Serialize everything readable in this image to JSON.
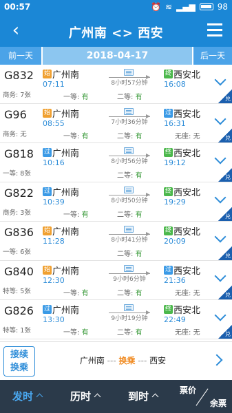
{
  "status_bar": {
    "time": "00:57",
    "battery": "98"
  },
  "header": {
    "title": "广州南 <> 西安",
    "back_icon": "back-chevron-icon",
    "menu_icon": "menu-icon"
  },
  "date_nav": {
    "prev_label": "前一天",
    "date": "2018-04-17",
    "next_label": "后一天"
  },
  "trains": [
    {
      "number": "G832",
      "origin_tag": "始",
      "origin": "广州南",
      "depart": "07:11",
      "duration": "8小时57分钟",
      "dest_tag": "终",
      "dest": "西安北",
      "arrive": "16:08",
      "seat_left": "商务: 7张",
      "seat_mid_label": "一等:",
      "seat_mid": "有",
      "seat_mid2_label": "二等:",
      "seat_mid2": "有",
      "seat_right_label": "",
      "seat_right": "",
      "redeem": "兑"
    },
    {
      "number": "G96",
      "origin_tag": "始",
      "origin": "广州南",
      "depart": "08:55",
      "duration": "7小时36分钟",
      "dest_tag": "过",
      "dest": "西安北",
      "arrive": "16:31",
      "seat_left": "商务: 无",
      "seat_mid_label": "一等:",
      "seat_mid": "有",
      "seat_mid2_label": "二等:",
      "seat_mid2": "有",
      "seat_right_label": "无座:",
      "seat_right": "无",
      "redeem": "兑"
    },
    {
      "number": "G818",
      "origin_tag": "过",
      "origin": "广州南",
      "depart": "10:16",
      "duration": "8小时56分钟",
      "dest_tag": "终",
      "dest": "西安北",
      "arrive": "19:12",
      "seat_left": "一等: 8张",
      "seat_mid_label": "",
      "seat_mid": "",
      "seat_mid2_label": "二等:",
      "seat_mid2": "有",
      "seat_right_label": "",
      "seat_right": "",
      "redeem": "兑"
    },
    {
      "number": "G822",
      "origin_tag": "过",
      "origin": "广州南",
      "depart": "10:39",
      "duration": "8小时50分钟",
      "dest_tag": "终",
      "dest": "西安北",
      "arrive": "19:29",
      "seat_left": "商务: 3张",
      "seat_mid_label": "一等:",
      "seat_mid": "有",
      "seat_mid2_label": "二等:",
      "seat_mid2": "有",
      "seat_right_label": "",
      "seat_right": "",
      "redeem": "兑"
    },
    {
      "number": "G836",
      "origin_tag": "始",
      "origin": "广州南",
      "depart": "11:28",
      "duration": "8小时41分钟",
      "dest_tag": "终",
      "dest": "西安北",
      "arrive": "20:09",
      "seat_left": "一等: 6张",
      "seat_mid_label": "",
      "seat_mid": "",
      "seat_mid2_label": "二等:",
      "seat_mid2": "有",
      "seat_right_label": "",
      "seat_right": "",
      "redeem": "兑"
    },
    {
      "number": "G840",
      "origin_tag": "始",
      "origin": "广州南",
      "depart": "12:30",
      "duration": "9小时6分钟",
      "dest_tag": "过",
      "dest": "西安北",
      "arrive": "21:36",
      "seat_left": "特等: 5张",
      "seat_mid_label": "一等:",
      "seat_mid": "有",
      "seat_mid2_label": "二等:",
      "seat_mid2": "有",
      "seat_right_label": "无座:",
      "seat_right": "无",
      "redeem": "兑"
    },
    {
      "number": "G826",
      "origin_tag": "过",
      "origin": "广州南",
      "depart": "13:30",
      "duration": "9小时19分钟",
      "dest_tag": "终",
      "dest": "西安北",
      "arrive": "22:49",
      "seat_left": "特等: 1张",
      "seat_mid_label": "一等:",
      "seat_mid": "有",
      "seat_mid2_label": "二等:",
      "seat_mid2": "有",
      "seat_right_label": "无座:",
      "seat_right": "无",
      "redeem": "兑"
    }
  ],
  "transfer": {
    "button_line1": "接续",
    "button_line2": "换乘",
    "from": "广州南",
    "dash1": "---",
    "via": "换乘",
    "dash2": "---",
    "to": "西安"
  },
  "sort_bar": {
    "depart_label": "发时",
    "duration_label": "历时",
    "arrive_label": "到时",
    "price_label": "票价",
    "remaining_label": "余票"
  },
  "colors": {
    "primary": "#1b87d6",
    "accent": "#4aa8f0",
    "available": "#3a9a3a",
    "highlight": "#f08a20",
    "sortbar_bg": "#2b3a4a"
  }
}
